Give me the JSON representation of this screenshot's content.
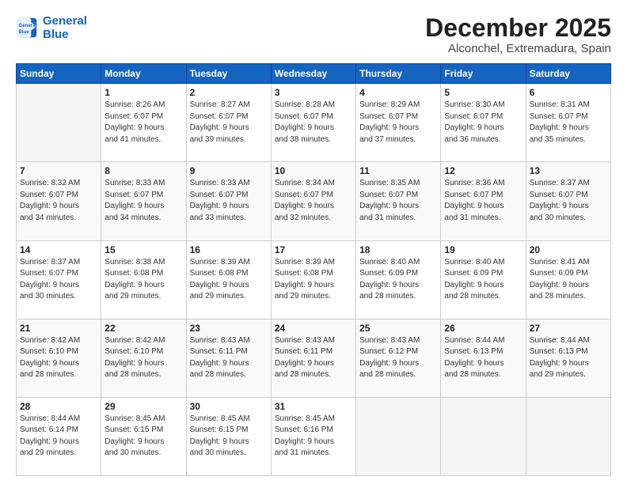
{
  "logo": {
    "line1": "General",
    "line2": "Blue"
  },
  "title": "December 2025",
  "subtitle": "Alconchel, Extremadura, Spain",
  "weekdays": [
    "Sunday",
    "Monday",
    "Tuesday",
    "Wednesday",
    "Thursday",
    "Friday",
    "Saturday"
  ],
  "weeks": [
    [
      {
        "day": "",
        "info": ""
      },
      {
        "day": "1",
        "info": "Sunrise: 8:26 AM\nSunset: 6:07 PM\nDaylight: 9 hours\nand 41 minutes."
      },
      {
        "day": "2",
        "info": "Sunrise: 8:27 AM\nSunset: 6:07 PM\nDaylight: 9 hours\nand 39 minutes."
      },
      {
        "day": "3",
        "info": "Sunrise: 8:28 AM\nSunset: 6:07 PM\nDaylight: 9 hours\nand 38 minutes."
      },
      {
        "day": "4",
        "info": "Sunrise: 8:29 AM\nSunset: 6:07 PM\nDaylight: 9 hours\nand 37 minutes."
      },
      {
        "day": "5",
        "info": "Sunrise: 8:30 AM\nSunset: 6:07 PM\nDaylight: 9 hours\nand 36 minutes."
      },
      {
        "day": "6",
        "info": "Sunrise: 8:31 AM\nSunset: 6:07 PM\nDaylight: 9 hours\nand 35 minutes."
      }
    ],
    [
      {
        "day": "7",
        "info": "Sunrise: 8:32 AM\nSunset: 6:07 PM\nDaylight: 9 hours\nand 34 minutes."
      },
      {
        "day": "8",
        "info": "Sunrise: 8:33 AM\nSunset: 6:07 PM\nDaylight: 9 hours\nand 34 minutes."
      },
      {
        "day": "9",
        "info": "Sunrise: 8:33 AM\nSunset: 6:07 PM\nDaylight: 9 hours\nand 33 minutes."
      },
      {
        "day": "10",
        "info": "Sunrise: 8:34 AM\nSunset: 6:07 PM\nDaylight: 9 hours\nand 32 minutes."
      },
      {
        "day": "11",
        "info": "Sunrise: 8:35 AM\nSunset: 6:07 PM\nDaylight: 9 hours\nand 31 minutes."
      },
      {
        "day": "12",
        "info": "Sunrise: 8:36 AM\nSunset: 6:07 PM\nDaylight: 9 hours\nand 31 minutes."
      },
      {
        "day": "13",
        "info": "Sunrise: 8:37 AM\nSunset: 6:07 PM\nDaylight: 9 hours\nand 30 minutes."
      }
    ],
    [
      {
        "day": "14",
        "info": "Sunrise: 8:37 AM\nSunset: 6:07 PM\nDaylight: 9 hours\nand 30 minutes."
      },
      {
        "day": "15",
        "info": "Sunrise: 8:38 AM\nSunset: 6:08 PM\nDaylight: 9 hours\nand 29 minutes."
      },
      {
        "day": "16",
        "info": "Sunrise: 8:39 AM\nSunset: 6:08 PM\nDaylight: 9 hours\nand 29 minutes."
      },
      {
        "day": "17",
        "info": "Sunrise: 8:39 AM\nSunset: 6:08 PM\nDaylight: 9 hours\nand 29 minutes."
      },
      {
        "day": "18",
        "info": "Sunrise: 8:40 AM\nSunset: 6:09 PM\nDaylight: 9 hours\nand 28 minutes."
      },
      {
        "day": "19",
        "info": "Sunrise: 8:40 AM\nSunset: 6:09 PM\nDaylight: 9 hours\nand 28 minutes."
      },
      {
        "day": "20",
        "info": "Sunrise: 8:41 AM\nSunset: 6:09 PM\nDaylight: 9 hours\nand 28 minutes."
      }
    ],
    [
      {
        "day": "21",
        "info": "Sunrise: 8:42 AM\nSunset: 6:10 PM\nDaylight: 9 hours\nand 28 minutes."
      },
      {
        "day": "22",
        "info": "Sunrise: 8:42 AM\nSunset: 6:10 PM\nDaylight: 9 hours\nand 28 minutes."
      },
      {
        "day": "23",
        "info": "Sunrise: 8:43 AM\nSunset: 6:11 PM\nDaylight: 9 hours\nand 28 minutes."
      },
      {
        "day": "24",
        "info": "Sunrise: 8:43 AM\nSunset: 6:11 PM\nDaylight: 9 hours\nand 28 minutes."
      },
      {
        "day": "25",
        "info": "Sunrise: 8:43 AM\nSunset: 6:12 PM\nDaylight: 9 hours\nand 28 minutes."
      },
      {
        "day": "26",
        "info": "Sunrise: 8:44 AM\nSunset: 6:13 PM\nDaylight: 9 hours\nand 28 minutes."
      },
      {
        "day": "27",
        "info": "Sunrise: 8:44 AM\nSunset: 6:13 PM\nDaylight: 9 hours\nand 29 minutes."
      }
    ],
    [
      {
        "day": "28",
        "info": "Sunrise: 8:44 AM\nSunset: 6:14 PM\nDaylight: 9 hours\nand 29 minutes."
      },
      {
        "day": "29",
        "info": "Sunrise: 8:45 AM\nSunset: 6:15 PM\nDaylight: 9 hours\nand 30 minutes."
      },
      {
        "day": "30",
        "info": "Sunrise: 8:45 AM\nSunset: 6:15 PM\nDaylight: 9 hours\nand 30 minutes."
      },
      {
        "day": "31",
        "info": "Sunrise: 8:45 AM\nSunset: 6:16 PM\nDaylight: 9 hours\nand 31 minutes."
      },
      {
        "day": "",
        "info": ""
      },
      {
        "day": "",
        "info": ""
      },
      {
        "day": "",
        "info": ""
      }
    ]
  ]
}
